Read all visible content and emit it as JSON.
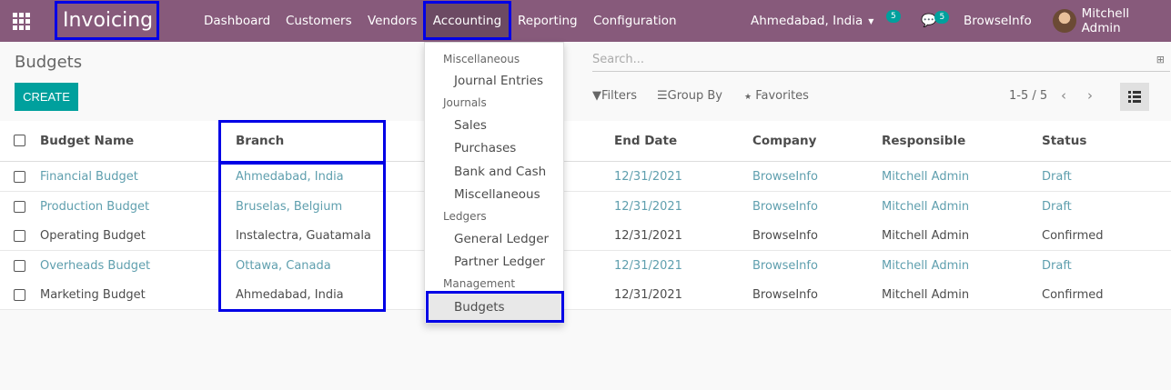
{
  "navbar": {
    "app_name": "Invoicing",
    "menu": [
      "Dashboard",
      "Customers",
      "Vendors",
      "Accounting",
      "Reporting",
      "Configuration"
    ],
    "branch": "Ahmedabad, India",
    "activity_count": "5",
    "message_count": "5",
    "company": "BrowseInfo",
    "user": "Mitchell Admin"
  },
  "page": {
    "title": "Budgets",
    "create_label": "CREATE",
    "search_placeholder": "Search...",
    "filters_label": "Filters",
    "groupby_label": "Group By",
    "favorites_label": "Favorites",
    "pager": "1-5 / 5"
  },
  "table": {
    "columns": [
      "Budget Name",
      "Branch",
      "End Date",
      "Company",
      "Responsible",
      "Status"
    ],
    "rows": [
      {
        "name": "Financial Budget",
        "branch": "Ahmedabad, India",
        "end_date": "12/31/2021",
        "company": "BrowseInfo",
        "responsible": "Mitchell Admin",
        "status": "Draft",
        "draft": true
      },
      {
        "name": "Production Budget",
        "branch": "Bruselas, Belgium",
        "end_date": "12/31/2021",
        "company": "BrowseInfo",
        "responsible": "Mitchell Admin",
        "status": "Draft",
        "draft": true
      },
      {
        "name": "Operating Budget",
        "branch": "Instalectra, Guatamala",
        "end_date": "12/31/2021",
        "company": "BrowseInfo",
        "responsible": "Mitchell Admin",
        "status": "Confirmed",
        "draft": false
      },
      {
        "name": "Overheads Budget",
        "branch": "Ottawa, Canada",
        "end_date": "12/31/2021",
        "company": "BrowseInfo",
        "responsible": "Mitchell Admin",
        "status": "Draft",
        "draft": true
      },
      {
        "name": "Marketing Budget",
        "branch": "Ahmedabad, India",
        "end_date": "12/31/2021",
        "company": "BrowseInfo",
        "responsible": "Mitchell Admin",
        "status": "Confirmed",
        "draft": false
      }
    ]
  },
  "dropdown": {
    "sections": [
      {
        "header": "Miscellaneous",
        "items": [
          "Journal Entries"
        ]
      },
      {
        "header": "Journals",
        "items": [
          "Sales",
          "Purchases",
          "Bank and Cash",
          "Miscellaneous"
        ]
      },
      {
        "header": "Ledgers",
        "items": [
          "General Ledger",
          "Partner Ledger"
        ]
      },
      {
        "header": "Management",
        "items": [
          "Budgets"
        ]
      }
    ]
  },
  "colors": {
    "navbar": "#875a7b",
    "accent": "#00a09d",
    "link": "#5f9fae",
    "highlight": "#0000e6"
  }
}
